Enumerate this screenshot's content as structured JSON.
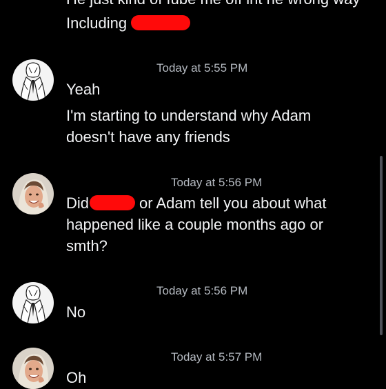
{
  "messages": [
    {
      "lines": [
        "He just kind of fube me off int he wrong way",
        "Including"
      ],
      "redacted_after": "Including"
    },
    {
      "author_avatar": "user-a-sketch-avatar",
      "timestamp": "Today at 5:55 PM",
      "lines": [
        "Yeah",
        "I'm starting to understand why Adam",
        "doesn't have any friends"
      ]
    },
    {
      "author_avatar": "user-b-photo-avatar",
      "timestamp": "Today at 5:56 PM",
      "line1_prefix": "Did",
      "line1_suffix": "or Adam tell you about what",
      "lines": [
        "happened like a couple months ago or",
        "smth?"
      ]
    },
    {
      "author_avatar": "user-a-sketch-avatar",
      "timestamp": "Today at 5:56 PM",
      "lines": [
        "No"
      ]
    },
    {
      "author_avatar": "user-b-photo-avatar",
      "timestamp": "Today at 5:57 PM",
      "lines": [
        "Oh"
      ]
    }
  ],
  "colors": {
    "background": "#000000",
    "text": "#f2f3f5",
    "timestamp": "#b5bac1",
    "redaction": "#ff0a0a"
  }
}
